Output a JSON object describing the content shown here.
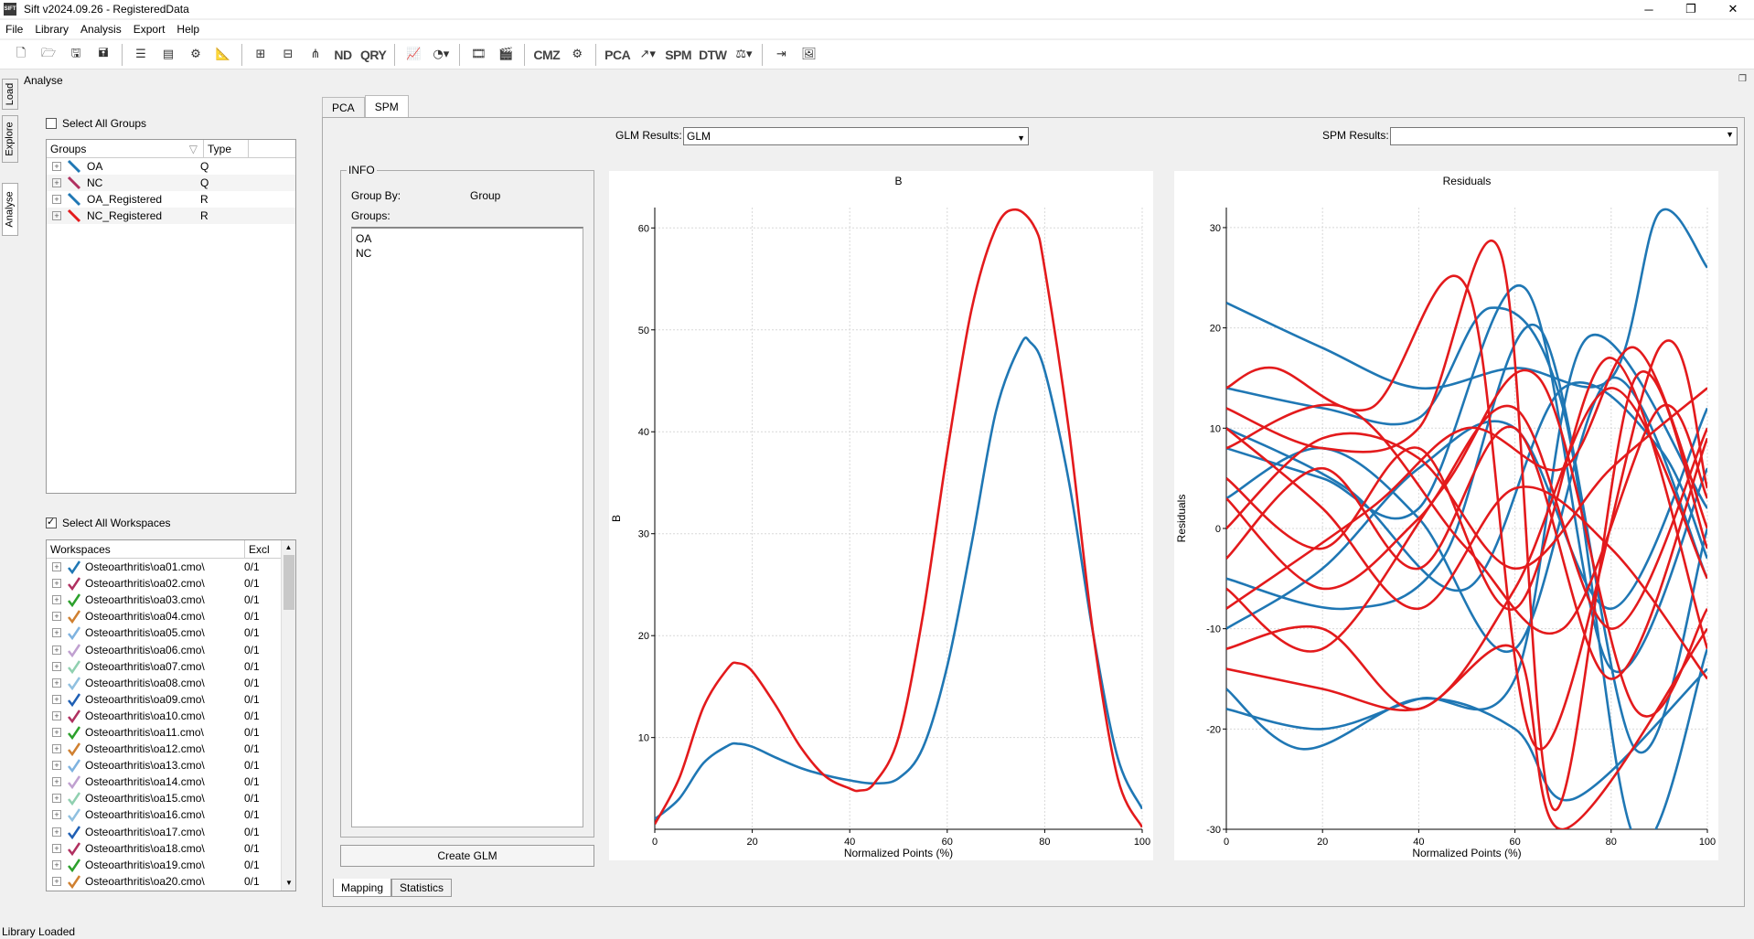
{
  "window": {
    "title": "Sift v2024.09.26 - RegisteredData",
    "icon_text": "SIFT"
  },
  "menu": [
    "File",
    "Library",
    "Analysis",
    "Export",
    "Help"
  ],
  "toolbar_text": {
    "pca": "PCA",
    "spm": "SPM",
    "dtw": "DTW",
    "nd": "ND",
    "qry": "QRY",
    "cmz": "CMZ"
  },
  "sidetabs": [
    "Load",
    "Explore",
    "Analyse"
  ],
  "panel_title": "Analyse",
  "groups": {
    "select_all_label": "Select All Groups",
    "select_all_checked": false,
    "headers": [
      "Groups",
      "Type"
    ],
    "rows": [
      {
        "name": "OA",
        "type": "Q",
        "color": "#1f77b4"
      },
      {
        "name": "NC",
        "type": "Q",
        "color": "#b03060"
      },
      {
        "name": "OA_Registered",
        "type": "R",
        "color": "#1f77b4"
      },
      {
        "name": "NC_Registered",
        "type": "R",
        "color": "#e31a1c"
      }
    ]
  },
  "workspaces": {
    "select_all_label": "Select All Workspaces",
    "select_all_checked": true,
    "headers": [
      "Workspaces",
      "Excl"
    ],
    "rows": [
      {
        "name": "Osteoarthritis\\oa01.cmo\\",
        "excl": "0/1",
        "color": "#1f77b4"
      },
      {
        "name": "Osteoarthritis\\oa02.cmo\\",
        "excl": "0/1",
        "color": "#b03060"
      },
      {
        "name": "Osteoarthritis\\oa03.cmo\\",
        "excl": "0/1",
        "color": "#2ca02c"
      },
      {
        "name": "Osteoarthritis\\oa04.cmo\\",
        "excl": "0/1",
        "color": "#d08030"
      },
      {
        "name": "Osteoarthritis\\oa05.cmo\\",
        "excl": "0/1",
        "color": "#7fb3e0"
      },
      {
        "name": "Osteoarthritis\\oa06.cmo\\",
        "excl": "0/1",
        "color": "#c0a0d0"
      },
      {
        "name": "Osteoarthritis\\oa07.cmo\\",
        "excl": "0/1",
        "color": "#90d0b0"
      },
      {
        "name": "Osteoarthritis\\oa08.cmo\\",
        "excl": "0/1",
        "color": "#90c0e0"
      },
      {
        "name": "Osteoarthritis\\oa09.cmo\\",
        "excl": "0/1",
        "color": "#1f5fb4"
      },
      {
        "name": "Osteoarthritis\\oa10.cmo\\",
        "excl": "0/1",
        "color": "#b03060"
      },
      {
        "name": "Osteoarthritis\\oa11.cmo\\",
        "excl": "0/1",
        "color": "#2ca02c"
      },
      {
        "name": "Osteoarthritis\\oa12.cmo\\",
        "excl": "0/1",
        "color": "#d08030"
      },
      {
        "name": "Osteoarthritis\\oa13.cmo\\",
        "excl": "0/1",
        "color": "#7fb3e0"
      },
      {
        "name": "Osteoarthritis\\oa14.cmo\\",
        "excl": "0/1",
        "color": "#c0a0d0"
      },
      {
        "name": "Osteoarthritis\\oa15.cmo\\",
        "excl": "0/1",
        "color": "#90d0b0"
      },
      {
        "name": "Osteoarthritis\\oa16.cmo\\",
        "excl": "0/1",
        "color": "#90c0e0"
      },
      {
        "name": "Osteoarthritis\\oa17.cmo\\",
        "excl": "0/1",
        "color": "#1f5fb4"
      },
      {
        "name": "Osteoarthritis\\oa18.cmo\\",
        "excl": "0/1",
        "color": "#b03060"
      },
      {
        "name": "Osteoarthritis\\oa19.cmo\\",
        "excl": "0/1",
        "color": "#2ca02c"
      },
      {
        "name": "Osteoarthritis\\oa20.cmo\\",
        "excl": "0/1",
        "color": "#d08030"
      }
    ]
  },
  "tabs": [
    "PCA",
    "SPM"
  ],
  "active_tab": "SPM",
  "glm": {
    "label": "GLM Results:",
    "value": "GLM"
  },
  "spm": {
    "label": "SPM Results:",
    "value": ""
  },
  "info": {
    "legend": "INFO",
    "group_by_label": "Group By:",
    "group_by_value": "Group",
    "groups_label": "Groups:",
    "groups_list": [
      "OA",
      "NC"
    ]
  },
  "create_glm_label": "Create GLM",
  "bottom_tabs": [
    "Mapping",
    "Statistics"
  ],
  "status": "Library Loaded",
  "chart_data": [
    {
      "type": "line",
      "title": "B",
      "xlabel": "Normalized Points (%)",
      "ylabel": "B",
      "xlim": [
        0,
        100
      ],
      "ylim": [
        1,
        62
      ],
      "xticks": [
        0,
        20,
        40,
        60,
        80,
        100
      ],
      "yticks": [
        10,
        20,
        30,
        40,
        50,
        60
      ],
      "grid": true,
      "series": [
        {
          "color": "#1f77b4",
          "x": [
            0,
            5,
            10,
            15,
            17,
            20,
            25,
            30,
            35,
            40,
            45,
            50,
            55,
            60,
            65,
            70,
            75,
            77,
            80,
            85,
            90,
            95,
            100
          ],
          "y": [
            2,
            4,
            7.5,
            9.2,
            9.4,
            9.1,
            8,
            7,
            6.3,
            5.8,
            5.5,
            6,
            9,
            17,
            29,
            42,
            48.5,
            48.8,
            46,
            35,
            20,
            8,
            3
          ]
        },
        {
          "color": "#e31a1c",
          "x": [
            0,
            5,
            10,
            15,
            17,
            20,
            25,
            30,
            35,
            40,
            42,
            45,
            50,
            55,
            60,
            65,
            70,
            74,
            78,
            80,
            85,
            90,
            95,
            100
          ],
          "y": [
            1.5,
            6,
            13,
            16.8,
            17.3,
            16.5,
            13,
            9,
            6.2,
            5,
            4.8,
            5.5,
            10,
            22,
            38,
            52,
            60,
            61.8,
            60,
            56,
            40,
            20,
            6,
            1.2
          ]
        }
      ]
    },
    {
      "type": "line",
      "title": "Residuals",
      "xlabel": "Normalized Points (%)",
      "ylabel": "Residuals",
      "xlim": [
        0,
        100
      ],
      "ylim": [
        -30,
        32
      ],
      "xticks": [
        0,
        20,
        40,
        60,
        80,
        100
      ],
      "yticks": [
        -30,
        -20,
        -10,
        0,
        10,
        20,
        30
      ],
      "grid": true,
      "series": [
        {
          "color": "#1f77b4",
          "x": [
            0,
            20,
            40,
            60,
            80,
            90,
            100
          ],
          "y": [
            22.5,
            18,
            14,
            16,
            15,
            31.5,
            26
          ]
        },
        {
          "color": "#1f77b4",
          "x": [
            0,
            16,
            40,
            60,
            72,
            100
          ],
          "y": [
            -16,
            -22,
            -17,
            -20,
            -27,
            -14
          ]
        },
        {
          "color": "#1f77b4",
          "x": [
            0,
            20,
            40,
            55,
            70,
            85,
            100
          ],
          "y": [
            14,
            12,
            11,
            22,
            12,
            -31,
            -12
          ]
        },
        {
          "color": "#1f77b4",
          "x": [
            0,
            20,
            40,
            60,
            75,
            100
          ],
          "y": [
            -18,
            -20,
            -17,
            -15,
            19,
            2
          ]
        },
        {
          "color": "#1f77b4",
          "x": [
            0,
            20,
            40,
            62,
            80,
            100
          ],
          "y": [
            8,
            5,
            2,
            24,
            -14,
            6
          ]
        },
        {
          "color": "#1f77b4",
          "x": [
            0,
            25,
            45,
            65,
            85,
            100
          ],
          "y": [
            -5,
            -8,
            -3,
            20,
            -22,
            0
          ]
        },
        {
          "color": "#1f77b4",
          "x": [
            0,
            20,
            40,
            60,
            80,
            100
          ],
          "y": [
            3,
            8,
            1,
            -12,
            15,
            -5
          ]
        },
        {
          "color": "#1f77b4",
          "x": [
            0,
            20,
            40,
            60,
            80,
            100
          ],
          "y": [
            -10,
            -4,
            6,
            10,
            -8,
            12
          ]
        },
        {
          "color": "#1f77b4",
          "x": [
            0,
            25,
            50,
            70,
            90,
            100
          ],
          "y": [
            10,
            4,
            -6,
            14,
            8,
            -3
          ]
        },
        {
          "color": "#e31a1c",
          "x": [
            0,
            20,
            40,
            57,
            68,
            85,
            100
          ],
          "y": [
            12,
            8,
            10,
            27.5,
            -28,
            15,
            -2
          ]
        },
        {
          "color": "#e31a1c",
          "x": [
            0,
            20,
            40,
            60,
            70,
            100
          ],
          "y": [
            -14,
            -16,
            -18,
            -12,
            -30,
            -10
          ]
        },
        {
          "color": "#e31a1c",
          "x": [
            0,
            20,
            40,
            60,
            80,
            100
          ],
          "y": [
            -12,
            -10,
            -18,
            -6,
            14,
            -5
          ]
        },
        {
          "color": "#e31a1c",
          "x": [
            0,
            10,
            30,
            50,
            65,
            90,
            100
          ],
          "y": [
            14,
            16,
            12,
            24,
            -22,
            18,
            4
          ]
        },
        {
          "color": "#e31a1c",
          "x": [
            0,
            20,
            40,
            60,
            80,
            100
          ],
          "y": [
            5,
            -2,
            8,
            -8,
            17,
            -12
          ]
        },
        {
          "color": "#e31a1c",
          "x": [
            0,
            20,
            40,
            60,
            80,
            100
          ],
          "y": [
            -3,
            6,
            -4,
            10,
            -15,
            9
          ]
        },
        {
          "color": "#e31a1c",
          "x": [
            0,
            25,
            50,
            70,
            90,
            100
          ],
          "y": [
            8,
            12,
            -2,
            -10,
            12,
            3
          ]
        },
        {
          "color": "#e31a1c",
          "x": [
            0,
            20,
            45,
            65,
            85,
            100
          ],
          "y": [
            -6,
            -12,
            4,
            15,
            -18,
            -8
          ]
        },
        {
          "color": "#e31a1c",
          "x": [
            0,
            20,
            40,
            60,
            80,
            100
          ],
          "y": [
            0,
            9,
            7,
            -4,
            6,
            14
          ]
        },
        {
          "color": "#e31a1c",
          "x": [
            0,
            20,
            40,
            60,
            80,
            100
          ],
          "y": [
            10,
            2,
            -8,
            4,
            -2,
            -15
          ]
        },
        {
          "color": "#e31a1c",
          "x": [
            0,
            30,
            50,
            70,
            85,
            100
          ],
          "y": [
            -8,
            2,
            10,
            6,
            18,
            0
          ]
        },
        {
          "color": "#e31a1c",
          "x": [
            0,
            20,
            40,
            60,
            80,
            100
          ],
          "y": [
            3,
            -6,
            1,
            12,
            -10,
            10
          ]
        }
      ]
    }
  ]
}
